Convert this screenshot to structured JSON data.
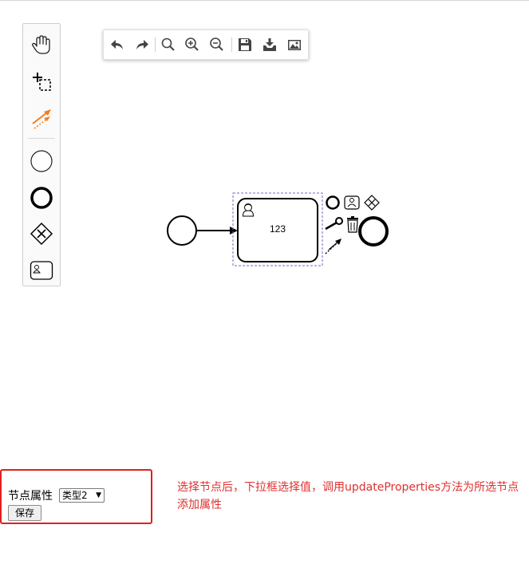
{
  "palette": {
    "items": [
      {
        "name": "hand-tool",
        "icon": "hand-icon"
      },
      {
        "name": "lasso-tool",
        "icon": "lasso-icon"
      },
      {
        "name": "global-connect-tool",
        "icon": "connect-icon"
      },
      {
        "name": "create-start-event",
        "icon": "start-event-icon"
      },
      {
        "name": "create-end-event",
        "icon": "end-event-icon"
      },
      {
        "name": "create-gateway",
        "icon": "gateway-icon"
      },
      {
        "name": "create-user-task",
        "icon": "user-task-icon"
      }
    ]
  },
  "toolbar": {
    "buttons": [
      "undo-icon",
      "redo-icon",
      "zoom-reset-icon",
      "zoom-in-icon",
      "zoom-out-icon",
      "save-icon",
      "download-icon",
      "image-icon"
    ]
  },
  "diagram": {
    "task_label": "123",
    "accent_color": "#f57c1f"
  },
  "properties": {
    "label": "节点属性",
    "select_value": "类型2",
    "save_label": "保存"
  },
  "note": {
    "text": "选择节点后，下拉框选择值，调用updateProperties方法为所选节点添加属性",
    "color": "#e03030"
  },
  "panel_border_color": "#e02020"
}
